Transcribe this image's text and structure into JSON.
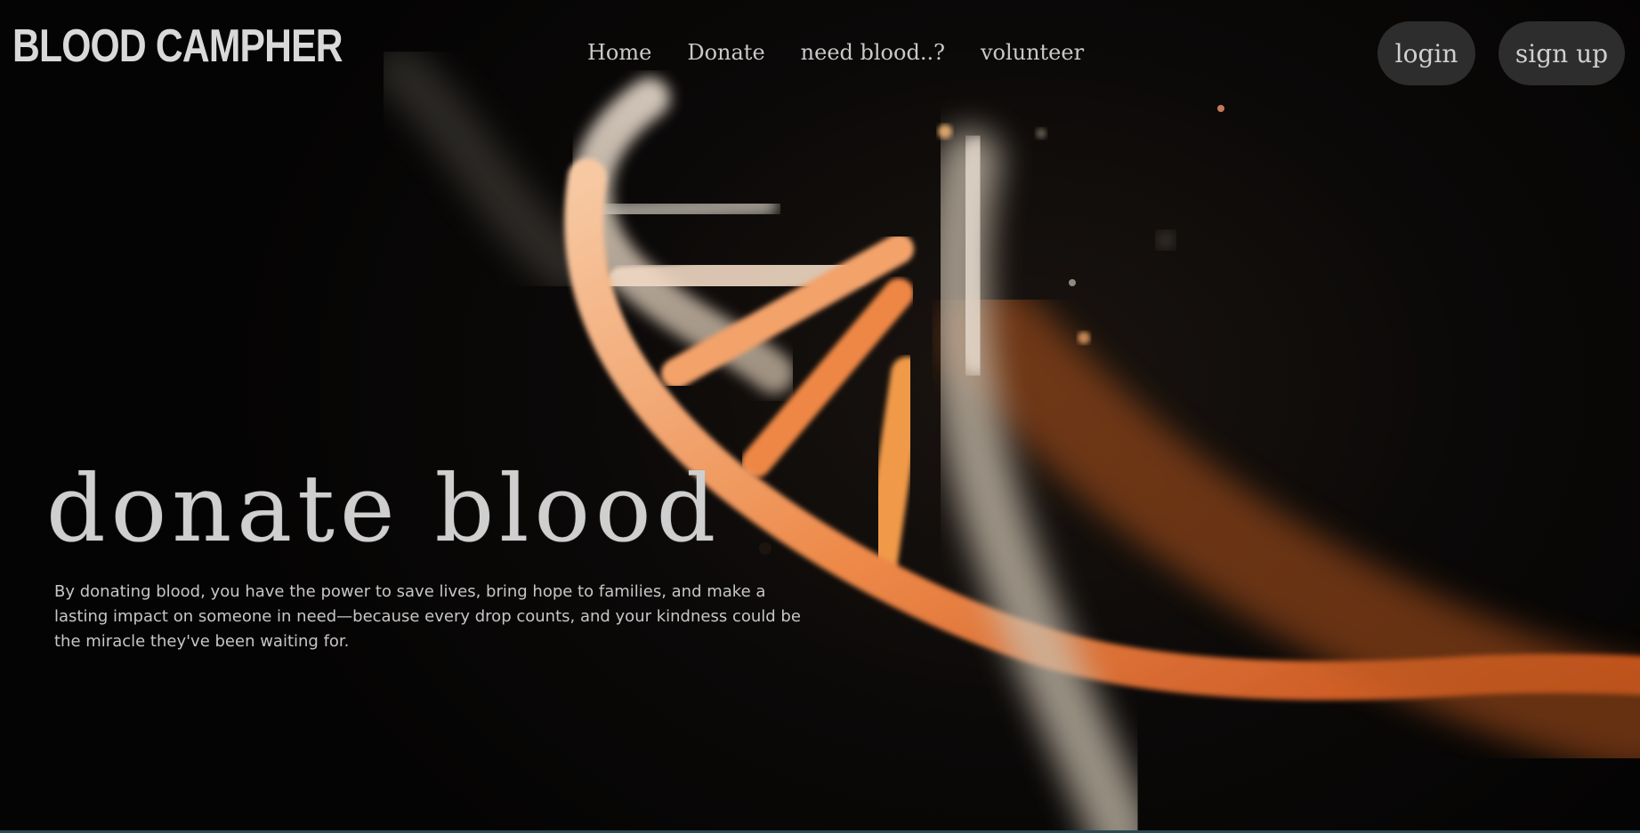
{
  "header": {
    "brand": "BLOOD CAMPHER",
    "nav": [
      "Home",
      "Donate",
      "need blood..?",
      "volunteer"
    ],
    "login_label": "login",
    "signup_label": "sign up"
  },
  "hero": {
    "title": "donate blood",
    "description": "By donating blood, you have the power to save lives, bring hope to families, and make a lasting impact on someone in need—because every drop counts, and your kindness could be the miracle they've been waiting for.",
    "image": "dna-helix-image"
  },
  "colors": {
    "background": "#070605",
    "text": "#cfcfcf",
    "button_bg": "#2d2d2d",
    "helix_orange": "#e8773a",
    "helix_light": "#f1dccb"
  }
}
